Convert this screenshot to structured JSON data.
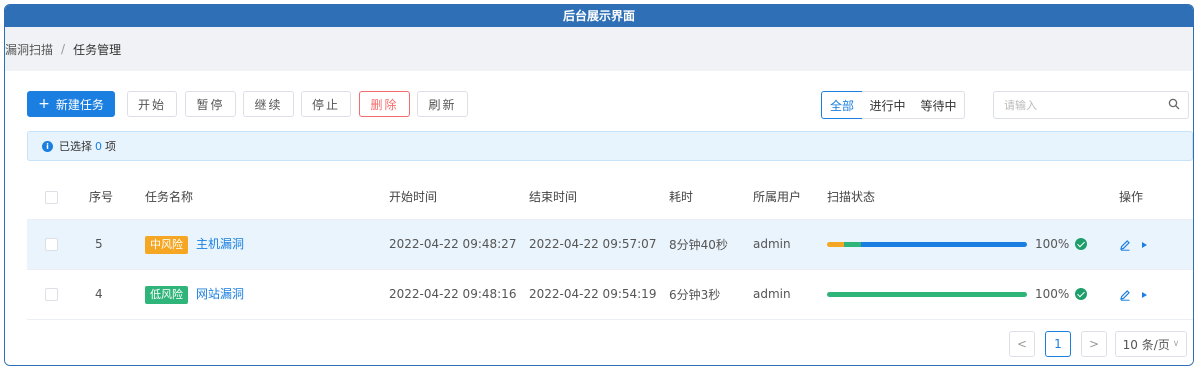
{
  "window": {
    "title": "后台展示界面"
  },
  "breadcrumb": {
    "items": [
      "漏洞扫描",
      "任务管理"
    ],
    "separator": "/"
  },
  "toolbar": {
    "new_task": "新建任务",
    "start": "开始",
    "pause": "暂停",
    "continue": "继续",
    "stop": "停止",
    "delete": "删除",
    "refresh": "刷新"
  },
  "filters": {
    "all": "全部",
    "running": "进行中",
    "waiting": "等待中",
    "active": "全部"
  },
  "search": {
    "placeholder": "请输入",
    "value": ""
  },
  "selection": {
    "prefix": "已选择",
    "count": "0",
    "suffix": "项"
  },
  "table": {
    "headers": {
      "index": "序号",
      "name": "任务名称",
      "start": "开始时间",
      "end": "结束时间",
      "duration": "耗时",
      "user": "所属用户",
      "status": "扫描状态",
      "ops": "操作"
    },
    "rows": [
      {
        "index": "5",
        "risk": "中风险",
        "risk_color": "#f5a623",
        "name": "主机漏洞",
        "start": "2022-04-22 09:48:27",
        "end": "2022-04-22 09:57:07",
        "duration": "8分钟40秒",
        "user": "admin",
        "progress": "100%",
        "segments": [
          {
            "color": "#f5a623",
            "from": 0,
            "to": 0.085
          },
          {
            "color": "#2fb57a",
            "from": 0.085,
            "to": 0.17
          },
          {
            "color": "#1a7fe0",
            "from": 0.17,
            "to": 1.0
          }
        ]
      },
      {
        "index": "4",
        "risk": "低风险",
        "risk_color": "#2fb57a",
        "name": "网站漏洞",
        "start": "2022-04-22 09:48:16",
        "end": "2022-04-22 09:54:19",
        "duration": "6分钟3秒",
        "user": "admin",
        "progress": "100%",
        "segments": [
          {
            "color": "#2fb57a",
            "from": 0,
            "to": 1.0
          }
        ]
      }
    ]
  },
  "pagination": {
    "prev": "<",
    "page": "1",
    "next": ">",
    "page_size": "10 条/页"
  },
  "colors": {
    "primary": "#1a7fe0",
    "title_bar": "#2e6fb5",
    "danger": "#f56c6c",
    "success": "#1e9e6b"
  }
}
